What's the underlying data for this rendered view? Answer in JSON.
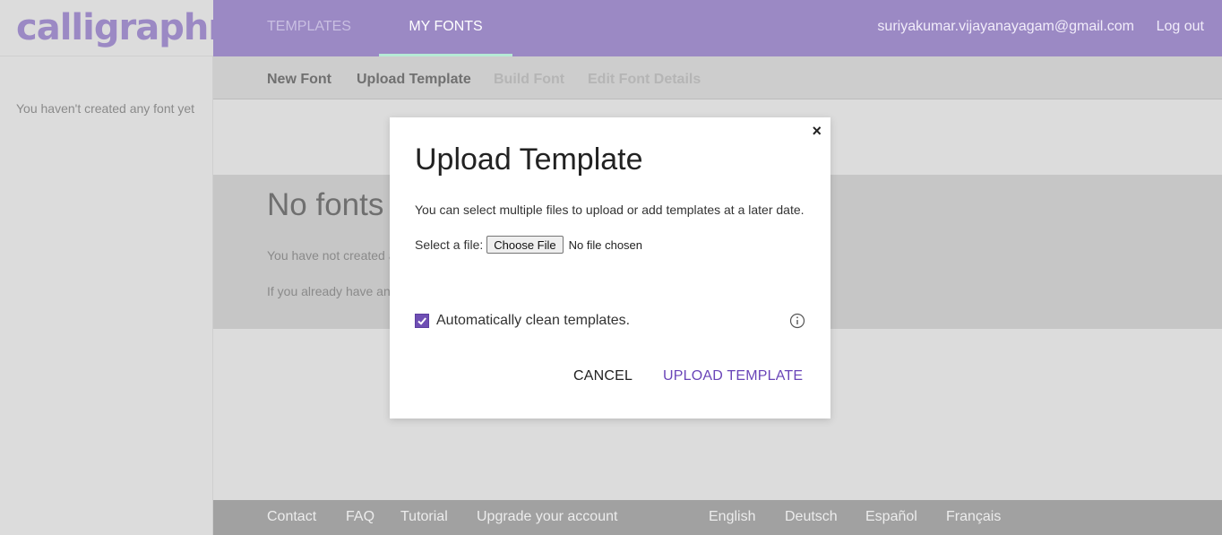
{
  "brand": {
    "logo_text": "calligraphr"
  },
  "topnav": {
    "templates": "TEMPLATES",
    "my_fonts": "MY FONTS",
    "user_email": "suriyakumar.vijayanayagam@gmail.com",
    "logout": "Log out"
  },
  "subnav": {
    "new_font": "New Font",
    "upload_template": "Upload Template",
    "build_font": "Build Font",
    "edit_details": "Edit Font Details"
  },
  "sidebar": {
    "empty_text": "You haven't created any font yet"
  },
  "content": {
    "title": "No fonts",
    "p1": "You have not created a",
    "p1_tail": ".",
    "p2": "If you already have an"
  },
  "modal": {
    "close": "×",
    "title": "Upload Template",
    "description": "You can select multiple files to upload or add templates at a later date.",
    "file_label": "Select a file:",
    "choose_file": "Choose File",
    "no_file": "No file chosen",
    "auto_clean_label": "Automatically clean templates.",
    "auto_clean_checked": true,
    "cancel": "CANCEL",
    "upload": "UPLOAD TEMPLATE"
  },
  "footer": {
    "contact": "Contact",
    "faq": "FAQ",
    "tutorial": "Tutorial",
    "upgrade": "Upgrade your account",
    "english": "English",
    "deutsch": "Deutsch",
    "espanol": "Español",
    "francais": "Français"
  },
  "colors": {
    "brand": "#9b89c4",
    "accent": "#6a45b8",
    "nav_underline": "#b6ead5"
  }
}
